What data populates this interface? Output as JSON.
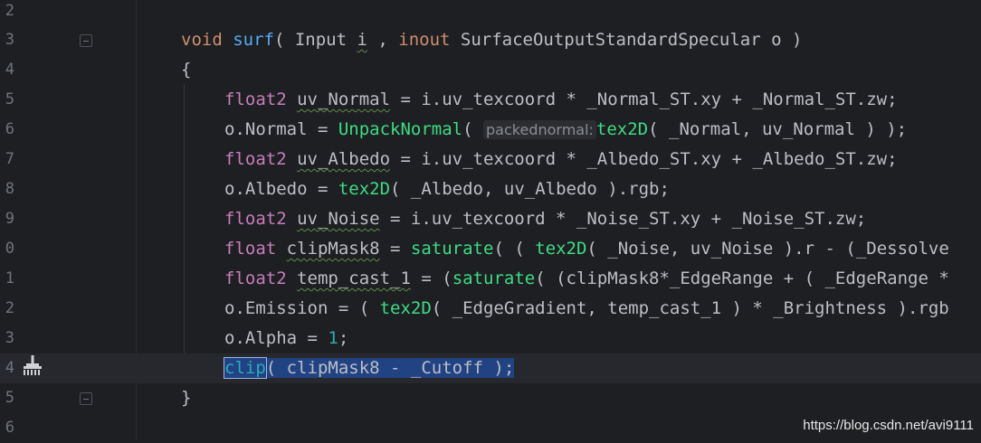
{
  "editor": {
    "line_numbers": [
      "2",
      "3",
      "4",
      "5",
      "6",
      "7",
      "8",
      "9",
      "0",
      "1",
      "2",
      "3",
      "4",
      "5",
      "6"
    ],
    "lines": {
      "l3": {
        "void": "void ",
        "surf": "surf",
        "p1": "( ",
        "Input": "Input ",
        "i": "i",
        "p2": " , ",
        "inout": "inout ",
        "SOSS": "SurfaceOutputStandardSpecular",
        "p3": " o )"
      },
      "l4": {
        "brace": "{"
      },
      "l5": {
        "float2": "float2 ",
        "var": "uv_Normal",
        "rest": " = i.uv_texcoord * _Normal_ST.xy + _Normal_ST.zw;"
      },
      "l6": {
        "lhs": "o.Normal = ",
        "fn": "UnpackNormal",
        "p1": "( ",
        "hint": "packednormal:",
        "tex2D": "tex2D",
        "rest": "( _Normal, uv_Normal ) );"
      },
      "l7": {
        "float2": "float2 ",
        "var": "uv_Albedo",
        "rest": " = i.uv_texcoord * _Albedo_ST.xy + _Albedo_ST.zw;"
      },
      "l8": {
        "lhs": "o.Albedo = ",
        "tex2D": "tex2D",
        "rest": "( _Albedo, uv_Albedo ).rgb;"
      },
      "l9": {
        "float2": "float2 ",
        "var": "uv_Noise",
        "rest": " = i.uv_texcoord * _Noise_ST.xy + _Noise_ST.zw;"
      },
      "l10": {
        "float": "float ",
        "var": "clipMask8",
        "eq": " = ",
        "sat": "saturate",
        "p1": "( ( ",
        "tex2D": "tex2D",
        "rest": "( _Noise, uv_Noise ).r - (_Dessolve"
      },
      "l11": {
        "float2": "float2 ",
        "var": "temp_cast_1",
        "eq": " = (",
        "sat": "saturate",
        "rest": "( (clipMask8*_EdgeRange + ( _EdgeRange *"
      },
      "l12": {
        "lhs": "o.Emission = ( ",
        "tex2D": "tex2D",
        "rest": "( _EdgeGradient, temp_cast_1 ) * _Brightness ).rgb"
      },
      "l13": {
        "lhs": "o.Alpha = ",
        "num": "1",
        "semi": ";"
      },
      "l14": {
        "clip": "clip",
        "rest": "( clipMask8 - _Cutoff );"
      },
      "l15": {
        "brace": "}"
      }
    }
  },
  "watermark": "https://blog.csdn.net/avi9111",
  "icons": {
    "gutter_action": "broom-icon",
    "fold": "fold-marker-icon"
  },
  "colors": {
    "background": "#1e1f22",
    "selection": "#214283",
    "keyword": "#cf8e6d",
    "function": "#56a8f5",
    "type": "#c77dbb"
  }
}
